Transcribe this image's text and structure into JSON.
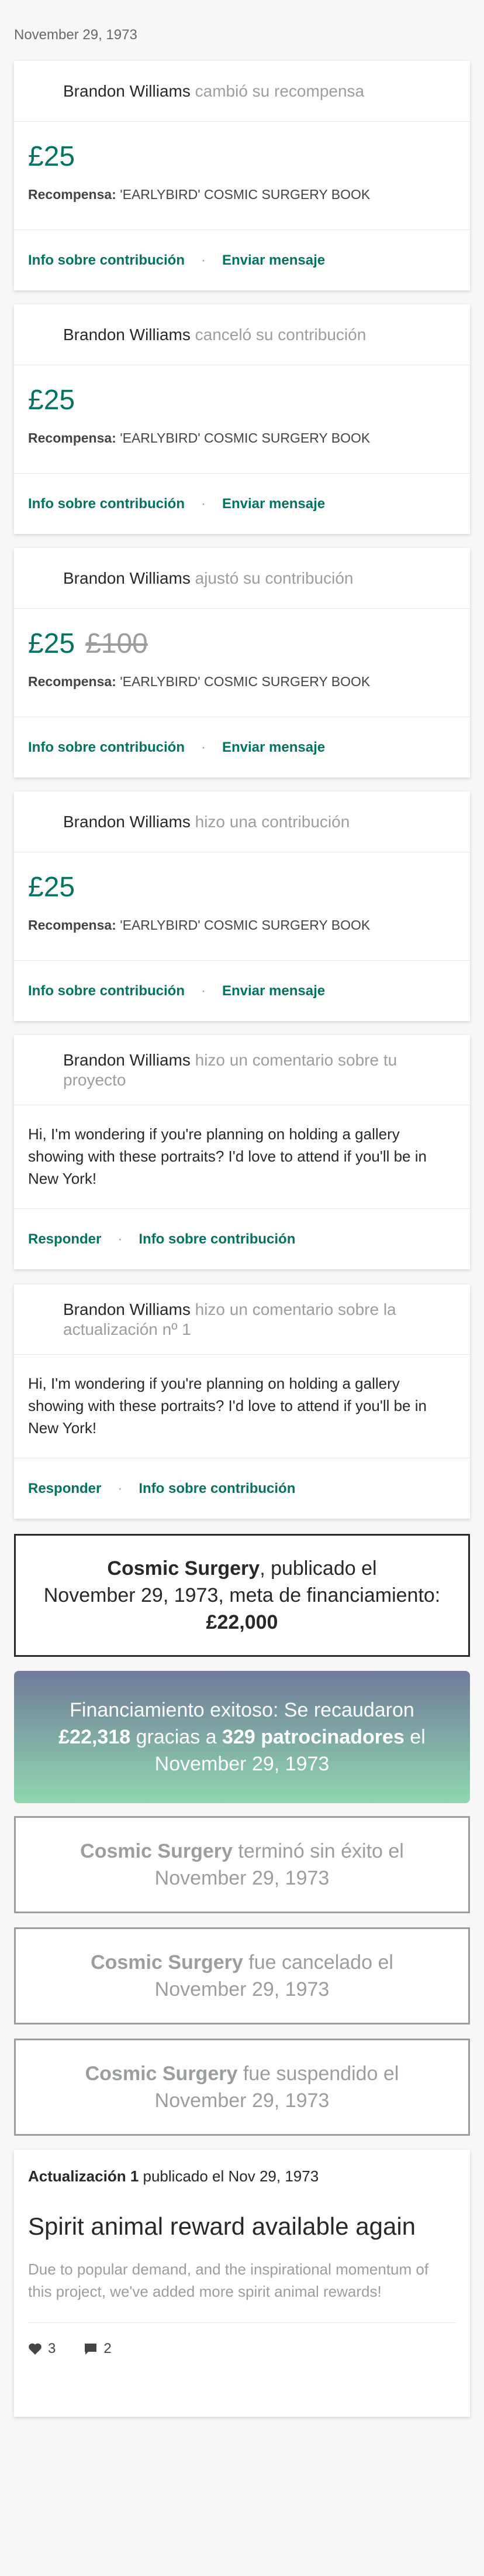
{
  "date_header": "November 29, 1973",
  "reward_cards": [
    {
      "user": "Brandon Williams",
      "action": "cambió su recompensa",
      "amount": "£25",
      "old_amount": "",
      "reward_label": "Recompensa:",
      "reward_name": "'EARLYBIRD' COSMIC SURGERY BOOK",
      "link1": "Info sobre contribución",
      "link2": "Enviar mensaje"
    },
    {
      "user": "Brandon Williams",
      "action": "canceló su contribución",
      "amount": "£25",
      "old_amount": "",
      "reward_label": "Recompensa:",
      "reward_name": "'EARLYBIRD' COSMIC SURGERY BOOK",
      "link1": "Info sobre contribución",
      "link2": "Enviar mensaje"
    },
    {
      "user": "Brandon Williams",
      "action": "ajustó su contribución",
      "amount": "£25",
      "old_amount": "£100",
      "reward_label": "Recompensa:",
      "reward_name": "'EARLYBIRD' COSMIC SURGERY BOOK",
      "link1": "Info sobre contribución",
      "link2": "Enviar mensaje"
    },
    {
      "user": "Brandon Williams",
      "action": "hizo una contribución",
      "amount": "£25",
      "old_amount": "",
      "reward_label": "Recompensa:",
      "reward_name": "'EARLYBIRD' COSMIC SURGERY BOOK",
      "link1": "Info sobre contribución",
      "link2": "Enviar mensaje"
    }
  ],
  "comment_cards": [
    {
      "user": "Brandon Williams",
      "action": "hizo un comentario sobre tu proyecto",
      "body": "Hi, I'm wondering if you're planning on holding a gallery showing with these portraits? I'd love to attend if you'll be in New York!",
      "link1": "Responder",
      "link2": "Info sobre contribución"
    },
    {
      "user": "Brandon Williams",
      "action": "hizo un comentario sobre la actualización nº 1",
      "body": "Hi, I'm wondering if you're planning on holding a gallery showing with these portraits? I'd love to attend if you'll be in New York!",
      "link1": "Responder",
      "link2": "Info sobre contribución"
    }
  ],
  "launch_event": {
    "project": "Cosmic Surgery",
    "text1": ", publicado el",
    "text2": "November 29, 1973, meta de financiamiento:",
    "goal": "£22,000"
  },
  "success_event": {
    "text1": "Financiamiento exitoso: Se recaudaron",
    "raised": "£22,318",
    "text2": "gracias a",
    "backers": "329 patrocinadores",
    "text3": "el",
    "date": "November 29, 1973"
  },
  "grey_events": [
    {
      "project": "Cosmic Surgery",
      "text": "terminó sin éxito el",
      "date": "November 29, 1973"
    },
    {
      "project": "Cosmic Surgery",
      "text": "fue cancelado el",
      "date": "November 29, 1973"
    },
    {
      "project": "Cosmic Surgery",
      "text": "fue suspendido el",
      "date": "November 29, 1973"
    }
  ],
  "update_card": {
    "label": "Actualización 1",
    "published": "publicado el Nov 29, 1973",
    "title": "Spirit animal reward available again",
    "description": "Due to popular demand, and the inspirational momentum of this project, we've added more spirit animal rewards!",
    "likes": "3",
    "comments": "2"
  },
  "colors": {
    "accent": "#037362",
    "muted": "#9b9e9e",
    "success_gradient_top": "#6f7b99",
    "success_gradient_bottom": "#8fd8b0"
  },
  "icons": {
    "like": "heart-icon",
    "comment": "comment-icon"
  }
}
